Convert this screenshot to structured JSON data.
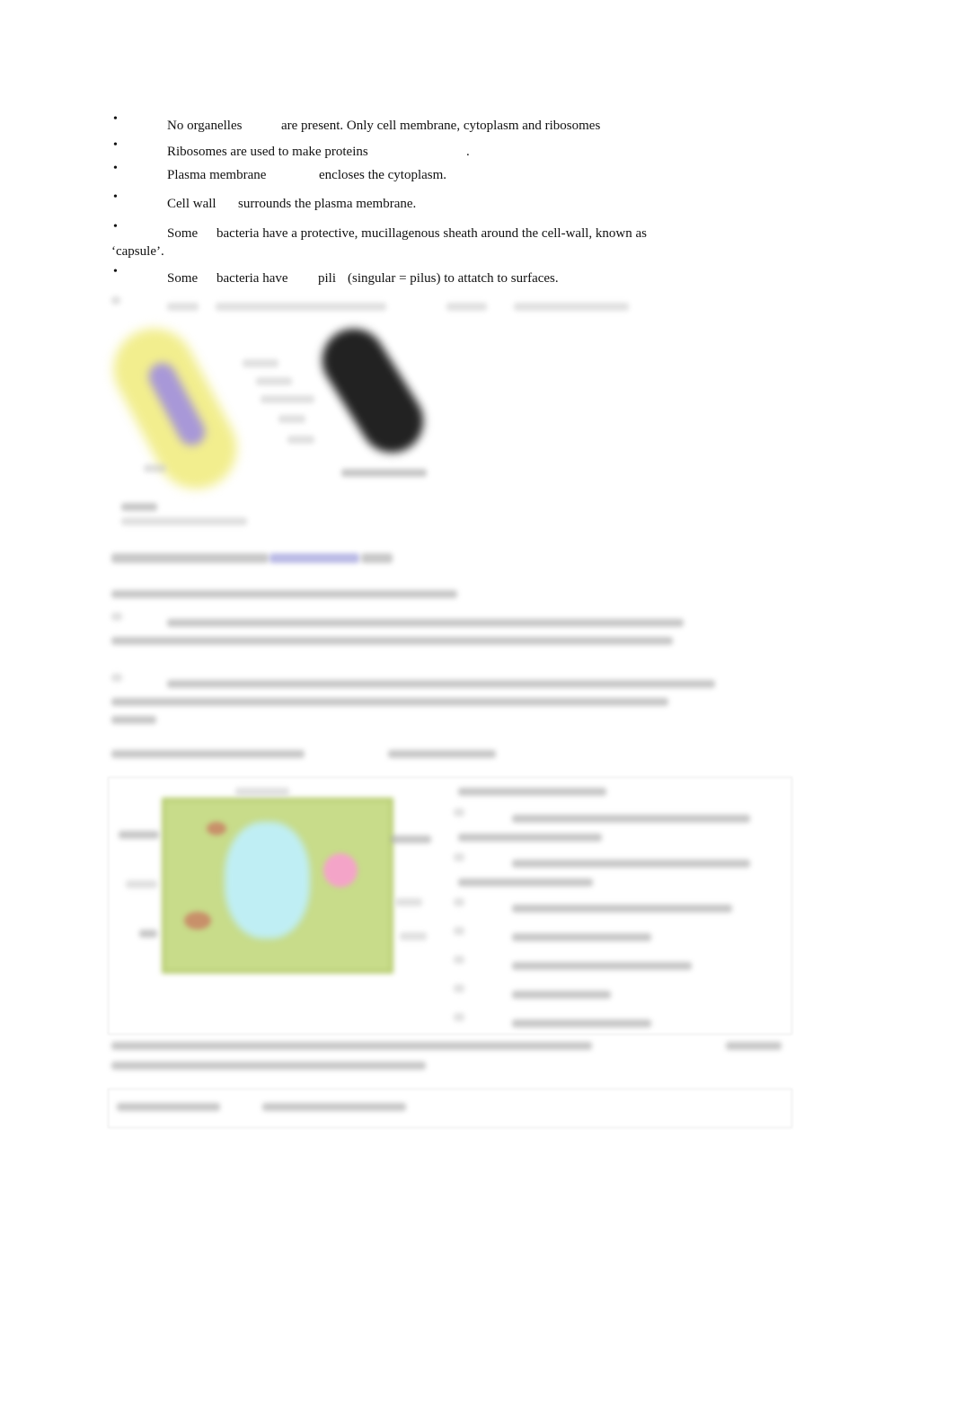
{
  "bullets": [
    {
      "a": "No organelles",
      "b": "are present. Only cell membrane, cytoplasm and ribosomes"
    },
    {
      "a": "Ribosomes are used to make proteins",
      "b": "."
    },
    {
      "a": "Plasma membrane",
      "b": "encloses the cytoplasm."
    },
    {
      "a": "Cell wall",
      "b": "surrounds the plasma membrane."
    },
    {
      "a": "Some",
      "b": "bacteria have a protective, mucillagenous sheath around the cell-wall, known as",
      "c": "‘capsule’."
    },
    {
      "a": "Some",
      "b": "bacteria have",
      "c": "pili",
      "d": "(singular = pilus) to attatch to surfaces."
    }
  ],
  "bullet_glyph": "•",
  "colors": {
    "link": "#8080d0",
    "cell_yellow": "#f3ef9a",
    "plant_green": "#c8dc8a",
    "vacuole": "#bfeef4"
  }
}
